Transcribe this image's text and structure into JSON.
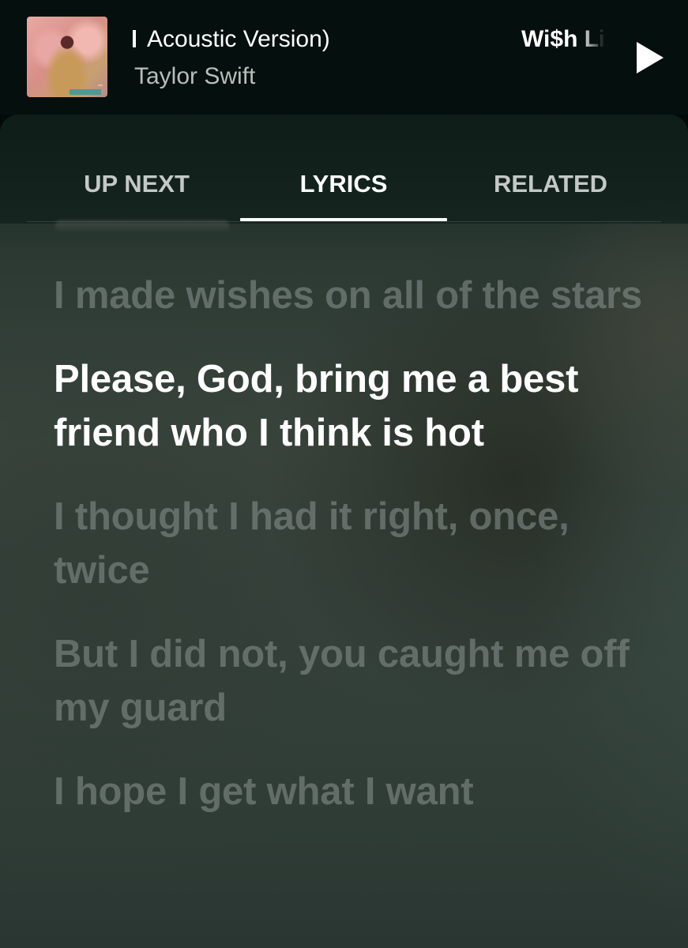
{
  "mini_player": {
    "title": "Acoustic Version)",
    "artist": "Taylor Swift",
    "next_title": "Wi$h Li",
    "play_icon": "play-icon",
    "album_art_icon": "album-cover"
  },
  "tabs": [
    {
      "label": "UP NEXT",
      "selected": false
    },
    {
      "label": "LYRICS",
      "selected": true
    },
    {
      "label": "RELATED",
      "selected": false
    }
  ],
  "lyrics": {
    "lines": [
      {
        "text": "I made wishes on all of the stars",
        "active": false
      },
      {
        "text": "Please, God, bring me a best friend who I think is hot",
        "active": true
      },
      {
        "text": "I thought I had it right, once, twice",
        "active": false
      },
      {
        "text": "But I did not, you caught me off my guard",
        "active": false
      },
      {
        "text": "I hope I get what I want",
        "active": false
      }
    ]
  },
  "colors": {
    "background": "#050f0d",
    "active_lyric": "#ffffff",
    "inactive_lyric": "#8c9691",
    "tab_indicator": "#ffffff"
  }
}
